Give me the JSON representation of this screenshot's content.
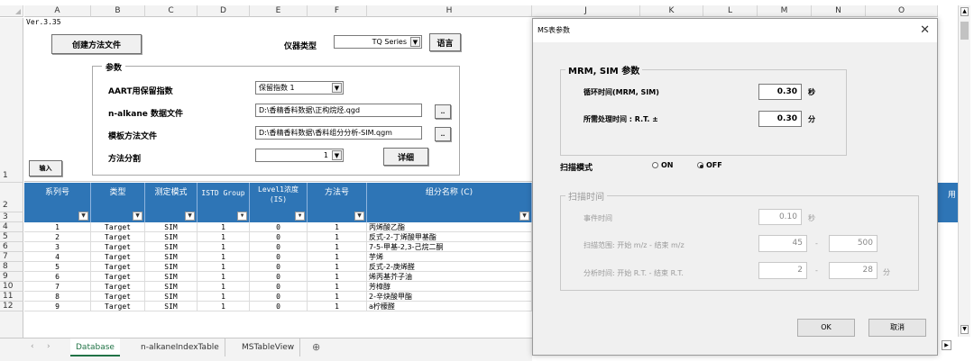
{
  "sheet": {
    "column_headers": [
      "A",
      "B",
      "C",
      "D",
      "E",
      "F",
      "H",
      "J",
      "K",
      "L",
      "M",
      "N",
      "O"
    ],
    "version": "Ver.3.35",
    "buttons": {
      "create_method": "创建方法文件",
      "language": "语言",
      "input": "输入",
      "detail": "详细",
      "browse": ".."
    },
    "instrument_type_label": "仪器类型",
    "instrument_type_value": "TQ Series",
    "params_group_label": "参数",
    "aart_label": "AART用保留指数",
    "aart_value": "保留指数 1",
    "nalkane_label": "n-alkane 数据文件",
    "nalkane_value": "D:\\香精香料数据\\正构烷烃.qgd",
    "template_label": "模板方法文件",
    "template_value": "D:\\香精香料数据\\香料组分分析-SIM.qgm",
    "split_label": "方法分割",
    "split_value": "1",
    "table_headers": [
      "系列号",
      "类型",
      "测定模式",
      "ISTD Group",
      "Level1浓度 (IS)",
      "方法号",
      "组分名称 (C)"
    ],
    "right_header_partial": "用",
    "row_numbers": [
      "1",
      "2",
      "3",
      "4",
      "5",
      "6",
      "7",
      "8",
      "9",
      "10",
      "11",
      "12"
    ],
    "rows": [
      {
        "no": "1",
        "type": "Target",
        "mode": "SIM",
        "istd": "1",
        "level": "0",
        "method": "1",
        "name": "丙烯酸乙酯"
      },
      {
        "no": "2",
        "type": "Target",
        "mode": "SIM",
        "istd": "1",
        "level": "0",
        "method": "1",
        "name": "反式-2-丁烯酸甲基酯"
      },
      {
        "no": "3",
        "type": "Target",
        "mode": "SIM",
        "istd": "1",
        "level": "0",
        "method": "1",
        "name": "7-5-甲基-2,3-己烷二酮"
      },
      {
        "no": "4",
        "type": "Target",
        "mode": "SIM",
        "istd": "1",
        "level": "0",
        "method": "1",
        "name": "芋烯"
      },
      {
        "no": "5",
        "type": "Target",
        "mode": "SIM",
        "istd": "1",
        "level": "0",
        "method": "1",
        "name": "反式-2-庚烯醛"
      },
      {
        "no": "6",
        "type": "Target",
        "mode": "SIM",
        "istd": "1",
        "level": "0",
        "method": "1",
        "name": "烯丙基芥子油"
      },
      {
        "no": "7",
        "type": "Target",
        "mode": "SIM",
        "istd": "1",
        "level": "0",
        "method": "1",
        "name": "芳樟醇"
      },
      {
        "no": "8",
        "type": "Target",
        "mode": "SIM",
        "istd": "1",
        "level": "0",
        "method": "1",
        "name": "2-辛炔酸甲酯"
      },
      {
        "no": "9",
        "type": "Target",
        "mode": "SIM",
        "istd": "1",
        "level": "0",
        "method": "1",
        "name": "a柠檬醛"
      }
    ],
    "tabs": [
      "Database",
      "n-alkaneIndexTable",
      "MSTableView"
    ],
    "add_sheet": "⊕"
  },
  "dialog": {
    "title": "MS表参数",
    "close": "✕",
    "mrm_group": "MRM, SIM 参数",
    "cycle_label": "循环时间(MRM, SIM)",
    "cycle_value": "0.30",
    "cycle_unit": "秒",
    "proc_label": "所需处理时间 : R.T. ±",
    "proc_value": "0.30",
    "proc_unit": "分",
    "scan_mode_label": "扫描模式",
    "on_label": "ON",
    "off_label": "OFF",
    "scan_time_group": "扫描时间",
    "event_label": "事件时间",
    "event_value": "0.10",
    "event_unit": "秒",
    "range_label": "扫描范围: 开始 m/z - 结束 m/z",
    "range_start": "45",
    "range_end": "500",
    "analysis_label": "分析时间: 开始 R.T. - 结束 R.T.",
    "analysis_start": "2",
    "analysis_end": "28",
    "analysis_unit": "分",
    "dash": "-",
    "ok": "OK",
    "cancel": "取消"
  }
}
